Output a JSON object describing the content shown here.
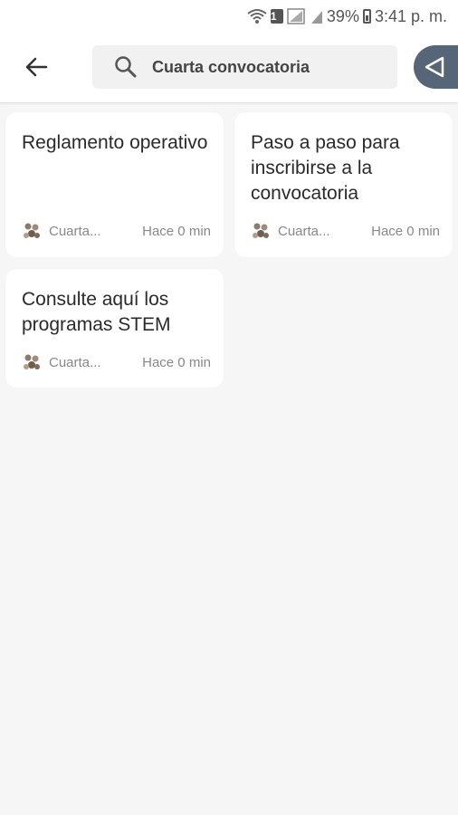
{
  "status_bar": {
    "battery": "39%",
    "time": "3:41 p. m.",
    "sim": "1"
  },
  "app_bar": {
    "search_query": "Cuarta convocatoria"
  },
  "cards": [
    {
      "title": "Reglamento operativo",
      "author": "Cuarta...",
      "time": "Hace 0 min"
    },
    {
      "title": "Paso a paso para inscribirse a la convocatoria",
      "author": "Cuarta...",
      "time": "Hace 0 min"
    },
    {
      "title": "Consulte aquí los programas STEM",
      "author": "Cuarta...",
      "time": "Hace 0 min"
    }
  ],
  "colors": {
    "accent": "#566578",
    "background": "#f6f6f6",
    "card": "#ffffff"
  }
}
